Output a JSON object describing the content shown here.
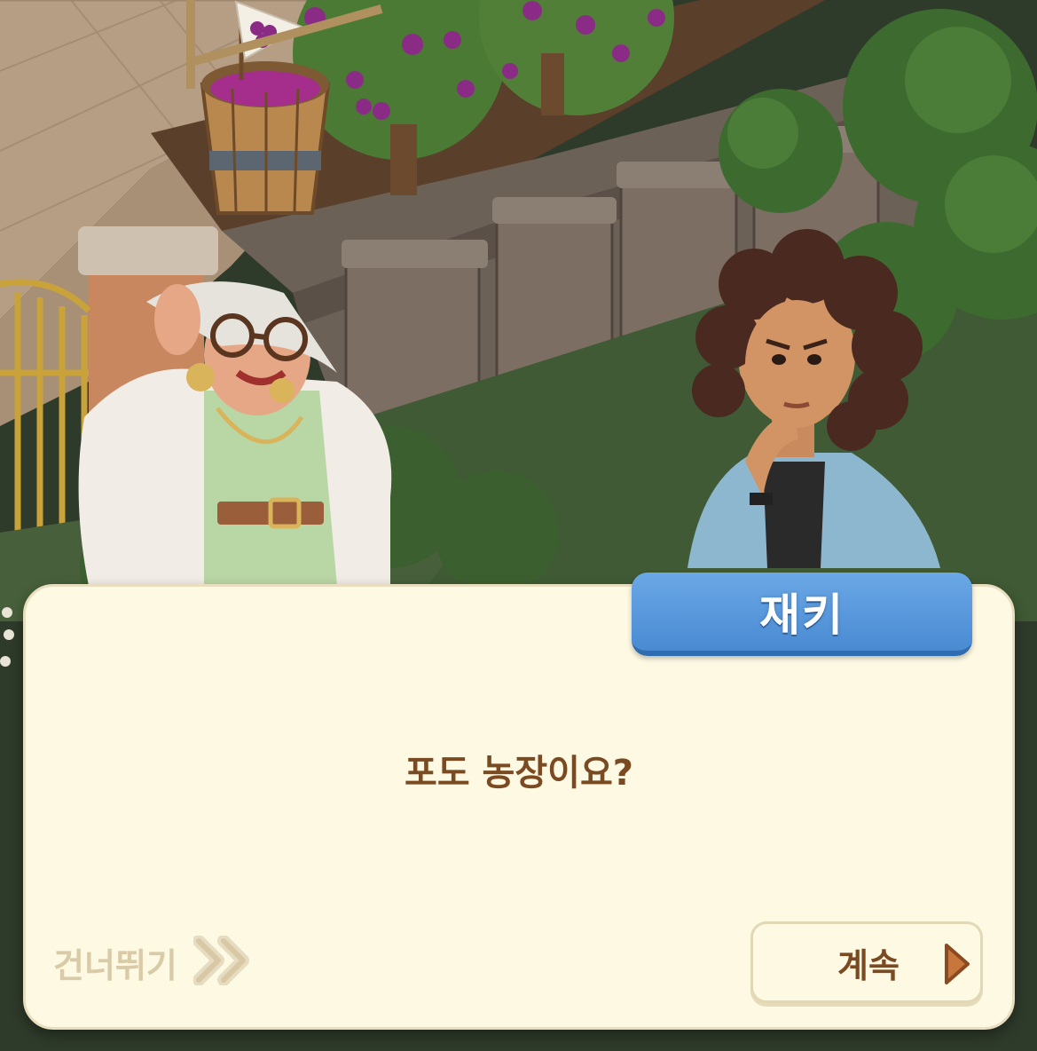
{
  "dialogue": {
    "speaker_name": "재키",
    "message": "포도 농장이요?"
  },
  "controls": {
    "skip_label": "건너뛰기",
    "continue_label": "계속"
  },
  "icons": {
    "skip": "double-chevron-right-icon",
    "continue": "play-triangle-icon"
  },
  "colors": {
    "dialog_background": "#fdf9e3",
    "nameplate_blue": "#4a8ad2",
    "text_brown": "#7a4a22",
    "skip_text": "#d9cba8",
    "continue_arrow": "#c7773c"
  }
}
